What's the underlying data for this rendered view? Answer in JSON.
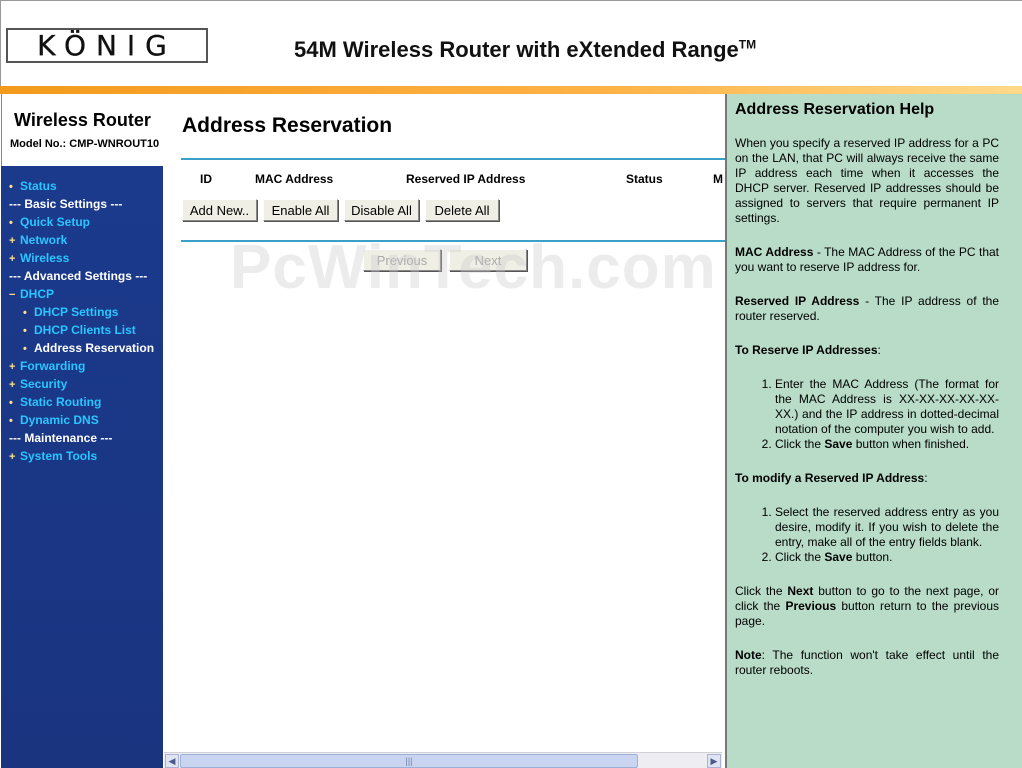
{
  "header": {
    "logo_text": "KÖNIG",
    "title": "54M Wireless Router with eXtended Range",
    "title_tm": "TM"
  },
  "brand": {
    "title": "Wireless Router",
    "model": "Model No.: CMP-WNROUT10"
  },
  "nav": [
    {
      "label": "Status",
      "kind": "item",
      "marker": "•"
    },
    {
      "label": "--- Basic Settings ---",
      "kind": "section"
    },
    {
      "label": "Quick Setup",
      "kind": "item",
      "marker": "•"
    },
    {
      "label": "Network",
      "kind": "item",
      "marker": "+"
    },
    {
      "label": "Wireless",
      "kind": "item",
      "marker": "+"
    },
    {
      "label": "--- Advanced Settings ---",
      "kind": "section"
    },
    {
      "label": "DHCP",
      "kind": "item",
      "marker": "−"
    },
    {
      "label": "DHCP Settings",
      "kind": "sub",
      "marker": "•"
    },
    {
      "label": "DHCP Clients List",
      "kind": "sub",
      "marker": "•"
    },
    {
      "label": "Address Reservation",
      "kind": "sub-current",
      "marker": "•"
    },
    {
      "label": "Forwarding",
      "kind": "item",
      "marker": "+"
    },
    {
      "label": "Security",
      "kind": "item",
      "marker": "+"
    },
    {
      "label": "Static Routing",
      "kind": "item",
      "marker": "•"
    },
    {
      "label": "Dynamic DNS",
      "kind": "item",
      "marker": "•"
    },
    {
      "label": "--- Maintenance ---",
      "kind": "section"
    },
    {
      "label": "System Tools",
      "kind": "item",
      "marker": "+"
    }
  ],
  "main": {
    "title": "Address Reservation",
    "columns": [
      "ID",
      "MAC Address",
      "Reserved IP Address",
      "Status",
      "M"
    ],
    "buttons": {
      "add_new": "Add New..",
      "enable_all": "Enable All",
      "disable_all": "Disable All",
      "delete_all": "Delete All",
      "previous": "Previous",
      "next": "Next"
    },
    "watermark": "PcWinTech.com"
  },
  "help": {
    "title": "Address Reservation Help",
    "intro": "When you specify a reserved IP address for a PC on the LAN, that PC will always receive the same IP address each time when it accesses the DHCP server. Reserved IP addresses should be assigned to servers that require permanent IP settings.",
    "mac_term": "MAC Address",
    "mac_desc": " - The MAC Address of the PC that you want to reserve IP address for.",
    "ip_term": "Reserved IP Address",
    "ip_desc": " - The IP address of the router reserved.",
    "reserve_heading": "To Reserve IP Addresses",
    "reserve_steps": {
      "step1": "Enter the MAC Address (The format for the MAC Address is XX-XX-XX-XX-XX-XX.) and the IP address in dotted-decimal notation of the computer you wish to add.",
      "step2_a": "Click the ",
      "step2_b": "Save",
      "step2_c": " button when finished."
    },
    "modify_heading": "To modify a Reserved IP Address",
    "modify_steps": {
      "step1": "Select the reserved address entry as you desire, modify it. If you wish to delete the entry, make all of the entry fields blank.",
      "step2_a": "Click the ",
      "step2_b": "Save",
      "step2_c": " button."
    },
    "nav_a": "Click the ",
    "nav_next": "Next",
    "nav_b": " button to go to the next page, or click the ",
    "nav_prev": "Previous",
    "nav_c": " button return to the previous page.",
    "note_term": "Note",
    "note_desc": ": The function won't take effect until the router reboots."
  }
}
